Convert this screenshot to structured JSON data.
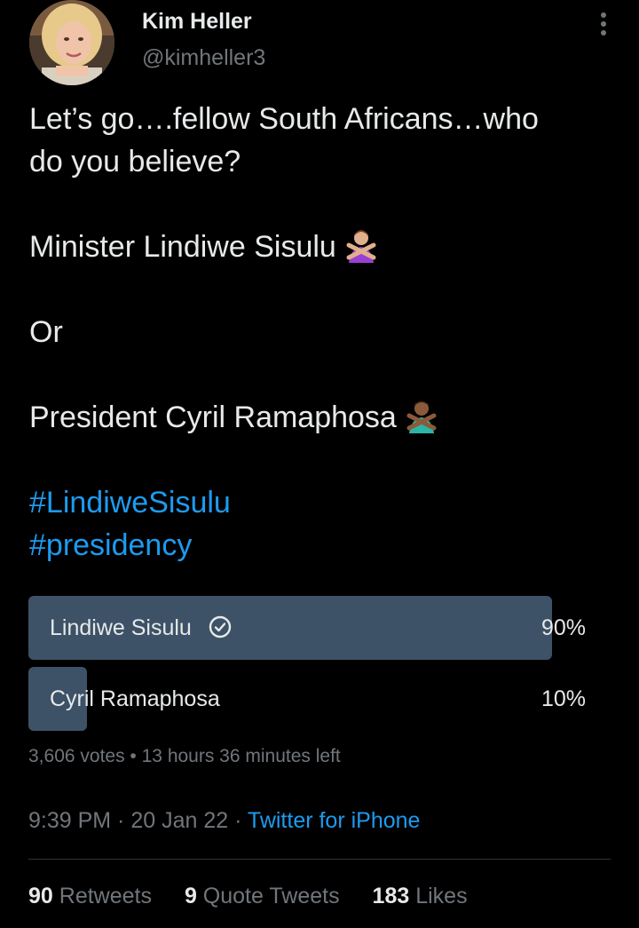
{
  "author": {
    "name": "Kim Heller",
    "handle": "@kimheller3"
  },
  "tweet": {
    "line1": "Let’s go….fellow South Africans…who",
    "line2": "do you believe?",
    "option_a": "Minister Lindiwe Sisulu",
    "connector": "Or",
    "option_b": "President Cyril Ramaphosa",
    "hashtags": [
      "#LindiweSisulu",
      "#presidency"
    ]
  },
  "emoji": {
    "option_a": "person-gesturing-no-light-skin",
    "option_b": "person-gesturing-no-dark-skin"
  },
  "poll": {
    "options": [
      {
        "label": "Lindiwe Sisulu",
        "percent": "90%",
        "value": 90,
        "winner": true
      },
      {
        "label": "Cyril Ramaphosa",
        "percent": "10%",
        "value": 10,
        "winner": false
      }
    ],
    "votes": "3,606 votes",
    "separator": " • ",
    "time_left": "13 hours 36 minutes left"
  },
  "meta": {
    "time": "9:39 PM",
    "sep1": " · ",
    "date": "20 Jan 22",
    "sep2": " · ",
    "source": "Twitter for iPhone"
  },
  "stats": {
    "retweets_count": "90",
    "retweets_label": " Retweets",
    "quotes_count": "9",
    "quotes_label": " Quote Tweets",
    "likes_count": "183",
    "likes_label": " Likes"
  },
  "colors": {
    "background": "#000000",
    "text": "#e7e9ea",
    "secondary": "#71767b",
    "link": "#1d9bf0",
    "poll_bar": "#3d5266",
    "divider": "#2f3336"
  },
  "icons": [
    "more-vertical-icon",
    "check-circle-icon"
  ]
}
